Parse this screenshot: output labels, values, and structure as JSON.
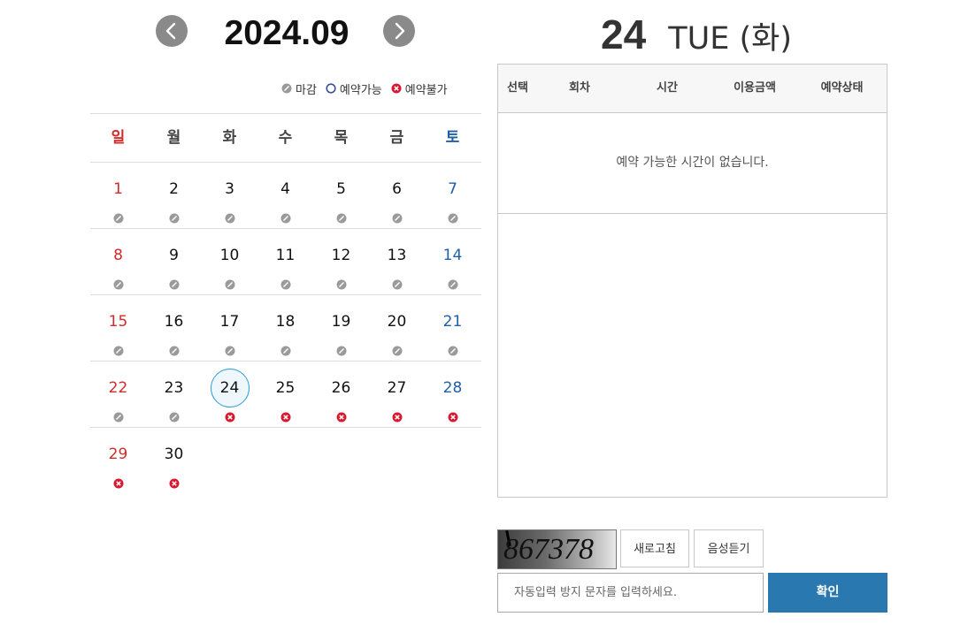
{
  "calendar": {
    "month_title": "2024.09",
    "legend": [
      {
        "status": "closed",
        "label": "마감"
      },
      {
        "status": "available",
        "label": "예약가능"
      },
      {
        "status": "unavailable",
        "label": "예약불가"
      }
    ],
    "weekdays": [
      "일",
      "월",
      "화",
      "수",
      "목",
      "금",
      "토"
    ],
    "selected_day": "24",
    "weeks": [
      [
        {
          "d": "1",
          "s": "closed"
        },
        {
          "d": "2",
          "s": "closed"
        },
        {
          "d": "3",
          "s": "closed"
        },
        {
          "d": "4",
          "s": "closed"
        },
        {
          "d": "5",
          "s": "closed"
        },
        {
          "d": "6",
          "s": "closed"
        },
        {
          "d": "7",
          "s": "closed"
        }
      ],
      [
        {
          "d": "8",
          "s": "closed"
        },
        {
          "d": "9",
          "s": "closed"
        },
        {
          "d": "10",
          "s": "closed"
        },
        {
          "d": "11",
          "s": "closed"
        },
        {
          "d": "12",
          "s": "closed"
        },
        {
          "d": "13",
          "s": "closed"
        },
        {
          "d": "14",
          "s": "closed"
        }
      ],
      [
        {
          "d": "15",
          "s": "closed"
        },
        {
          "d": "16",
          "s": "closed"
        },
        {
          "d": "17",
          "s": "closed"
        },
        {
          "d": "18",
          "s": "closed"
        },
        {
          "d": "19",
          "s": "closed"
        },
        {
          "d": "20",
          "s": "closed"
        },
        {
          "d": "21",
          "s": "closed"
        }
      ],
      [
        {
          "d": "22",
          "s": "closed"
        },
        {
          "d": "23",
          "s": "closed"
        },
        {
          "d": "24",
          "s": "unavailable"
        },
        {
          "d": "25",
          "s": "unavailable"
        },
        {
          "d": "26",
          "s": "unavailable"
        },
        {
          "d": "27",
          "s": "unavailable"
        },
        {
          "d": "28",
          "s": "unavailable"
        }
      ],
      [
        {
          "d": "29",
          "s": "unavailable"
        },
        {
          "d": "30",
          "s": "unavailable"
        },
        {
          "d": "",
          "s": ""
        },
        {
          "d": "",
          "s": ""
        },
        {
          "d": "",
          "s": ""
        },
        {
          "d": "",
          "s": ""
        },
        {
          "d": "",
          "s": ""
        }
      ]
    ],
    "colors": {
      "sunday": "#d42a2a",
      "saturday": "#1f5fa8",
      "closed": "#9a9a9a",
      "available": "#3b4f9e",
      "unavailable": "#d8192f",
      "nav_button": "#8a8a8a"
    },
    "icons": {
      "prev": "chevron-left-icon",
      "next": "chevron-right-icon"
    }
  },
  "detail": {
    "day": "24",
    "weekday": "TUE (화)",
    "table_headers": {
      "select": "선택",
      "round": "회차",
      "time": "시간",
      "price": "이용금액",
      "status": "예약상태"
    },
    "empty_message": "예약 가능한 시간이 없습니다."
  },
  "captcha": {
    "code": "867378",
    "refresh_label": "새로고침",
    "audio_label": "음성듣기",
    "input_placeholder": "자동입력 방지 문자를 입력하세요.",
    "input_value": "",
    "confirm_label": "확인",
    "confirm_color": "#2a78b0"
  }
}
